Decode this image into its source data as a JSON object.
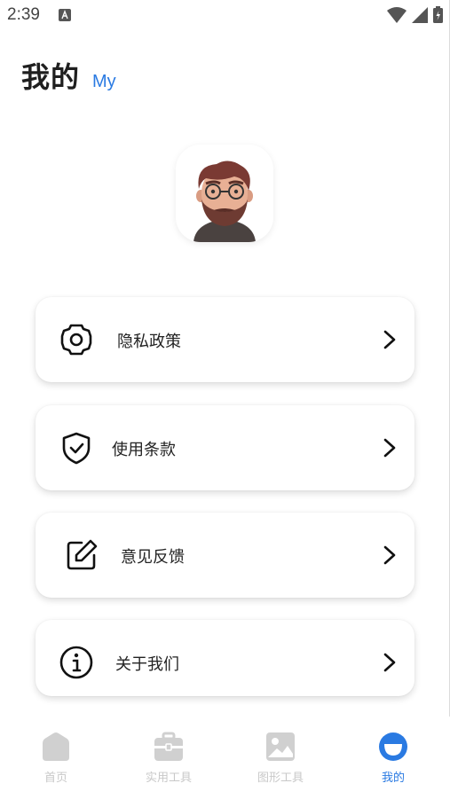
{
  "status_bar": {
    "time": "2:39"
  },
  "header": {
    "title": "我的",
    "subtitle": "My"
  },
  "menu": [
    {
      "label": "隐私政策",
      "icon": "gear-icon"
    },
    {
      "label": "使用条款",
      "icon": "shield-check-icon"
    },
    {
      "label": "意见反馈",
      "icon": "edit-icon"
    },
    {
      "label": "关于我们",
      "icon": "info-icon"
    }
  ],
  "tabs": [
    {
      "label": "首页",
      "icon": "home-icon",
      "active": false
    },
    {
      "label": "实用工具",
      "icon": "briefcase-icon",
      "active": false
    },
    {
      "label": "图形工具",
      "icon": "image-icon",
      "active": false
    },
    {
      "label": "我的",
      "icon": "profile-icon",
      "active": true
    }
  ],
  "colors": {
    "accent": "#2a7ae2",
    "inactive": "#c8c8c8"
  }
}
